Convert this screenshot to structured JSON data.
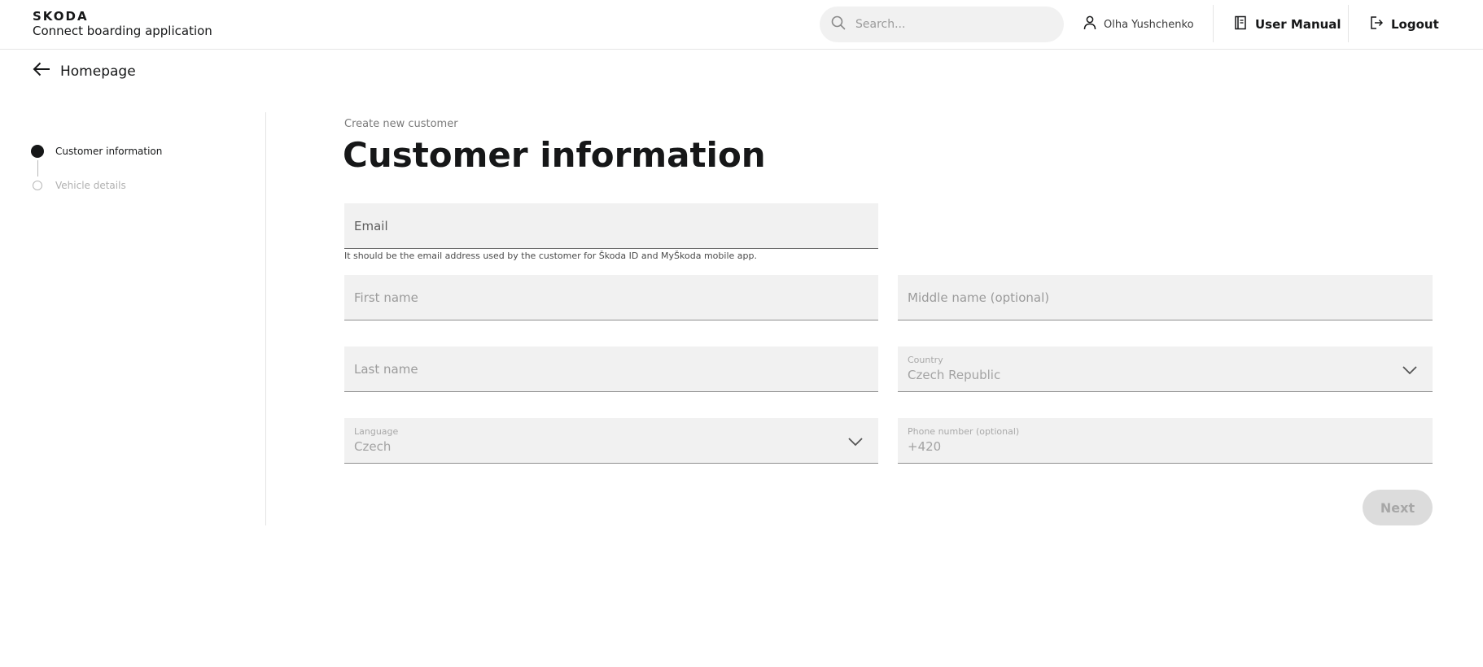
{
  "header": {
    "brand_logo": "SKODA",
    "brand_sub": "Connect boarding application",
    "search_placeholder": "Search...",
    "user_name": "Olha Yushchenko",
    "user_manual": "User Manual",
    "logout": "Logout"
  },
  "nav": {
    "back_label": "Homepage"
  },
  "stepper": {
    "steps": [
      {
        "label": "Customer information",
        "state": "active"
      },
      {
        "label": "Vehicle details",
        "state": "inactive"
      }
    ]
  },
  "form": {
    "subtitle": "Create new customer",
    "title": "Customer information",
    "email_placeholder": "Email",
    "email_helper": "It should be the email address used by the customer for Škoda ID and MyŠkoda mobile app.",
    "first_name_placeholder": "First name",
    "middle_name_placeholder": "Middle name (optional)",
    "last_name_placeholder": "Last name",
    "country_label": "Country",
    "country_value": "Czech Republic",
    "language_label": "Language",
    "language_value": "Czech",
    "phone_label": "Phone number (optional)",
    "phone_value": "+420",
    "next_label": "Next"
  },
  "icons": {
    "search": "search-icon",
    "user": "user-icon",
    "manual": "book-icon",
    "logout": "logout-icon",
    "back": "arrow-left-icon",
    "chevron": "chevron-down-icon"
  }
}
